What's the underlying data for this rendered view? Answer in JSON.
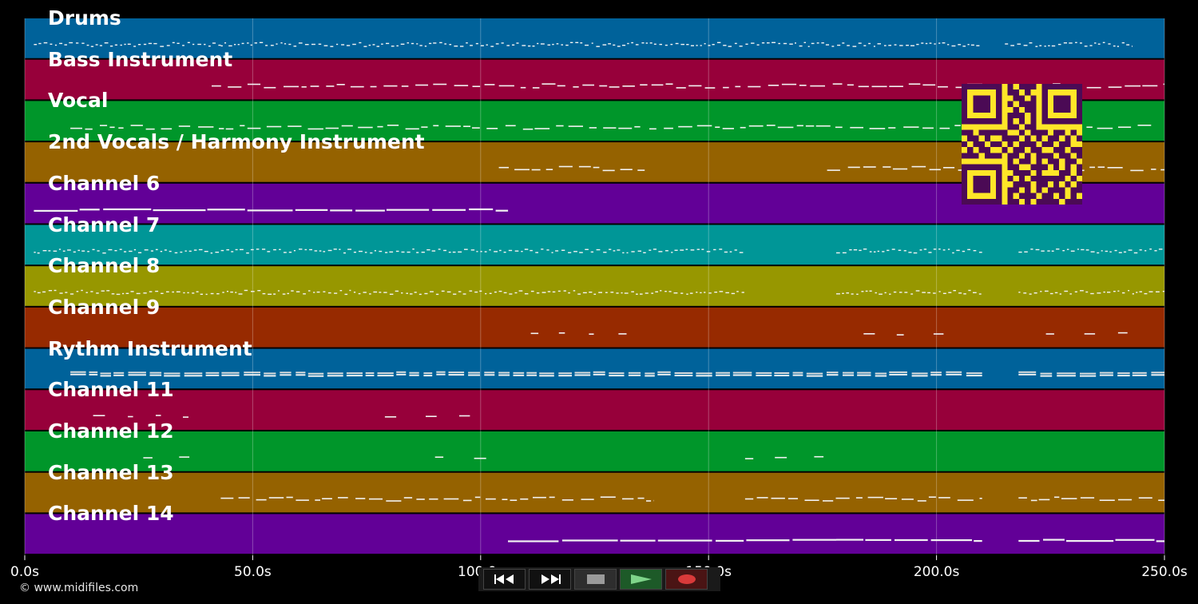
{
  "timeline": {
    "min_seconds": 0,
    "max_seconds": 250,
    "ticks": [
      {
        "value": 0,
        "label": "0.0s"
      },
      {
        "value": 50,
        "label": "50.0s"
      },
      {
        "value": 100,
        "label": "100.0s"
      },
      {
        "value": 150,
        "label": "150.0s"
      },
      {
        "value": 200,
        "label": "200.0s"
      },
      {
        "value": 250,
        "label": "250.0s"
      }
    ]
  },
  "tracks": [
    {
      "name": "Drums",
      "color": "#00629a",
      "pattern": "dots",
      "segments": [
        [
          2,
          43
        ],
        [
          43,
          100
        ],
        [
          100,
          210
        ],
        [
          215,
          243
        ]
      ]
    },
    {
      "name": "Bass Instrument",
      "color": "#97003a",
      "pattern": "dash",
      "segments": [
        [
          41,
          250
        ]
      ]
    },
    {
      "name": "Vocal",
      "color": "#00962a",
      "pattern": "dash",
      "segments": [
        [
          10,
          135
        ],
        [
          137,
          210
        ],
        [
          216,
          248
        ]
      ]
    },
    {
      "name": "2nd Vocals / Harmony Instrument",
      "color": "#956200",
      "pattern": "dash",
      "segments": [
        [
          104,
          136
        ],
        [
          176,
          250
        ]
      ]
    },
    {
      "name": "Channel 6",
      "color": "#620097",
      "pattern": "long",
      "segments": [
        [
          2,
          106
        ]
      ]
    },
    {
      "name": "Channel 7",
      "color": "#009697",
      "pattern": "dots",
      "segments": [
        [
          2,
          158
        ],
        [
          178,
          210
        ],
        [
          218,
          250
        ]
      ]
    },
    {
      "name": "Channel 8",
      "color": "#979700",
      "pattern": "dots",
      "segments": [
        [
          2,
          158
        ],
        [
          178,
          210
        ],
        [
          218,
          250
        ]
      ]
    },
    {
      "name": "Channel 9",
      "color": "#972a00",
      "pattern": "short",
      "segments": [
        [
          111,
          132
        ],
        [
          184,
          205
        ],
        [
          224,
          245
        ]
      ]
    },
    {
      "name": "Rythm Instrument",
      "color": "#00629a",
      "pattern": "double",
      "segments": [
        [
          10,
          210
        ],
        [
          218,
          250
        ]
      ]
    },
    {
      "name": "Channel 11",
      "color": "#97003a",
      "pattern": "short",
      "segments": [
        [
          15,
          36
        ],
        [
          79,
          100
        ]
      ]
    },
    {
      "name": "Channel 12",
      "color": "#00962a",
      "pattern": "short",
      "segments": [
        [
          26,
          42
        ],
        [
          90,
          106
        ],
        [
          158,
          178
        ]
      ]
    },
    {
      "name": "Channel 13",
      "color": "#956200",
      "pattern": "dash",
      "segments": [
        [
          43,
          138
        ],
        [
          158,
          210
        ],
        [
          218,
          250
        ]
      ]
    },
    {
      "name": "Channel 14",
      "color": "#620097",
      "pattern": "long",
      "segments": [
        [
          106,
          178
        ],
        [
          178,
          210
        ],
        [
          218,
          250
        ]
      ]
    }
  ],
  "overlay": {
    "qr_icon": "qr-code-icon",
    "qr_fg": "#ffe628",
    "qr_bg": "#4b0a55"
  },
  "transport": {
    "buttons": [
      {
        "name": "rewind-button",
        "icon": "rewind-icon"
      },
      {
        "name": "fast-forward-button",
        "icon": "fast-forward-icon"
      },
      {
        "name": "stop-button",
        "icon": "stop-icon"
      },
      {
        "name": "play-button",
        "icon": "play-icon"
      },
      {
        "name": "record-button",
        "icon": "record-icon"
      }
    ]
  },
  "footer": {
    "copyright": "© www.midifiles.com"
  }
}
